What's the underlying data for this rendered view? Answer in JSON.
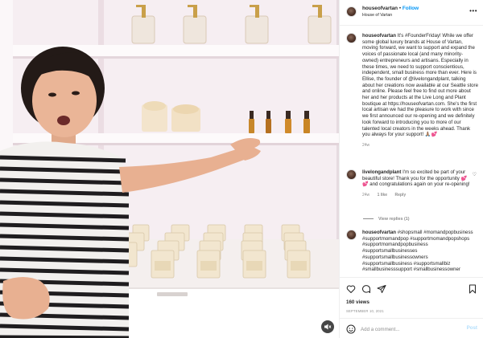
{
  "header": {
    "username": "houseofvartan",
    "separator": "•",
    "follow_label": "Follow",
    "location": "House of Vartan",
    "more_icon": "more-horizontal-icon"
  },
  "caption": {
    "username": "houseofvartan",
    "text": "It's #FounderFriday! While we offer some global luxury brands at House of Vartan, moving forward, we want to support and expand the voices of passionate local (and many minority-owned) entrepreneurs and artisans. Especially in these times, we need to support conscientious, independent, small business more than ever. Here is Ellise, the founder of @livelongandplant, talking about her creations now available at our Seattle store and online. Please feel free to find out more about her and her products at the Live Long and Plant boutique at https://houseofvartan.com. She's the first local artisan we had the pleasure to work with since we first announced our re-opening and we definitely look forward to introducing you to more of our talented local creators in the weeks ahead. Thank you always for your support! 🙏🏽💕",
    "age": "24w"
  },
  "comments": [
    {
      "username": "livelongandplant",
      "text": "I'm so excited be part of your beautiful store! Thank you for the opportunity 💕💕 and congratulations again on your re-opening!",
      "age": "24w",
      "likes": "1 like",
      "reply_label": "Reply",
      "view_replies": "View replies (1)"
    },
    {
      "username": "houseofvartan",
      "text": "#shopsmall #momandpopbusiness #supportmomandpop #supportmomandpopshops #supportmomandpopbusiness #supportsmallbusinesses #supportsmallbusinessowners #supportsmallbusiness #supportsmallbiz #smallbusinesssupport #smallbusinessowner"
    }
  ],
  "actions": {
    "likes": "160 views",
    "date": "SEPTEMBER 10, 2021",
    "icons": [
      "heart-icon",
      "comment-icon",
      "share-icon",
      "bookmark-icon"
    ]
  },
  "add_comment": {
    "placeholder": "Add a comment...",
    "post_label": "Post"
  },
  "media": {
    "mute_icon": "volume-muted-icon"
  }
}
